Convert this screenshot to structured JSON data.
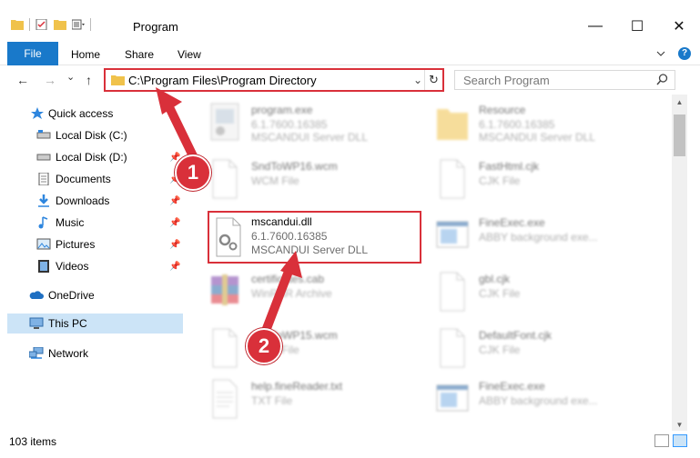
{
  "window": {
    "title": "Program",
    "minimize": "—",
    "maximize": "☐",
    "close": "✕"
  },
  "ribbon": {
    "tabs": [
      "File",
      "Home",
      "Share",
      "View"
    ],
    "help": "?"
  },
  "nav": {
    "back": "←",
    "forward": "→",
    "recent": "⌄",
    "up": "↑"
  },
  "address": {
    "path": "C:\\Program Files\\Program Directory",
    "dropdown": "⌄",
    "refresh": "↻"
  },
  "search": {
    "placeholder": "Search Program"
  },
  "sidebar": {
    "items": [
      {
        "label": "Quick access",
        "pinned": false
      },
      {
        "label": "Local Disk (C:)",
        "pinned": false
      },
      {
        "label": "Local Disk (D:)",
        "pinned": true
      },
      {
        "label": "Documents",
        "pinned": true
      },
      {
        "label": "Downloads",
        "pinned": true
      },
      {
        "label": "Music",
        "pinned": true
      },
      {
        "label": "Pictures",
        "pinned": true
      },
      {
        "label": "Videos",
        "pinned": true
      },
      {
        "label": "OneDrive",
        "pinned": false
      },
      {
        "label": "This PC",
        "pinned": false
      },
      {
        "label": "Network",
        "pinned": false
      }
    ]
  },
  "files": [
    {
      "name": "program.exe",
      "line1": "6.1.7600.16385",
      "line2": "MSCANDUI Server DLL",
      "icon": "exe-icon"
    },
    {
      "name": "Resource",
      "line1": "6.1.7600.16385",
      "line2": "MSCANDUI Server DLL",
      "icon": "folder-icon"
    },
    {
      "name": "SndToWP16.wcm",
      "line1": "WCM File",
      "line2": "",
      "icon": "blank-file-icon"
    },
    {
      "name": "FastHtml.cjk",
      "line1": "CJK File",
      "line2": "",
      "icon": "blank-file-icon"
    },
    {
      "name": "mscandui.dll",
      "line1": "6.1.7600.16385",
      "line2": "MSCANDUI Server DLL",
      "icon": "dll-gear-icon"
    },
    {
      "name": "FineExec.exe",
      "line1": "ABBY background exe...",
      "line2": "",
      "icon": "window-exe-icon"
    },
    {
      "name": "certificates.cab",
      "line1": "WinRAR Archive",
      "line2": "",
      "icon": "winrar-icon"
    },
    {
      "name": "gbl.cjk",
      "line1": "CJK File",
      "line2": "",
      "icon": "blank-file-icon"
    },
    {
      "name": "SndToWP15.wcm",
      "line1": "WCM File",
      "line2": "",
      "icon": "blank-file-icon"
    },
    {
      "name": "DefaultFont.cjk",
      "line1": "CJK File",
      "line2": "",
      "icon": "blank-file-icon"
    },
    {
      "name": "help.fineReader.txt",
      "line1": "TXT File",
      "line2": "",
      "icon": "text-file-icon"
    },
    {
      "name": "FineExec.exe",
      "line1": "ABBY background exe...",
      "line2": "",
      "icon": "window-exe-icon"
    }
  ],
  "annotations": [
    "1",
    "2"
  ],
  "status": {
    "count": "103 items"
  },
  "colors": {
    "accent": "#1979ca",
    "highlight": "#d9303a",
    "selected": "#cce4f7"
  }
}
